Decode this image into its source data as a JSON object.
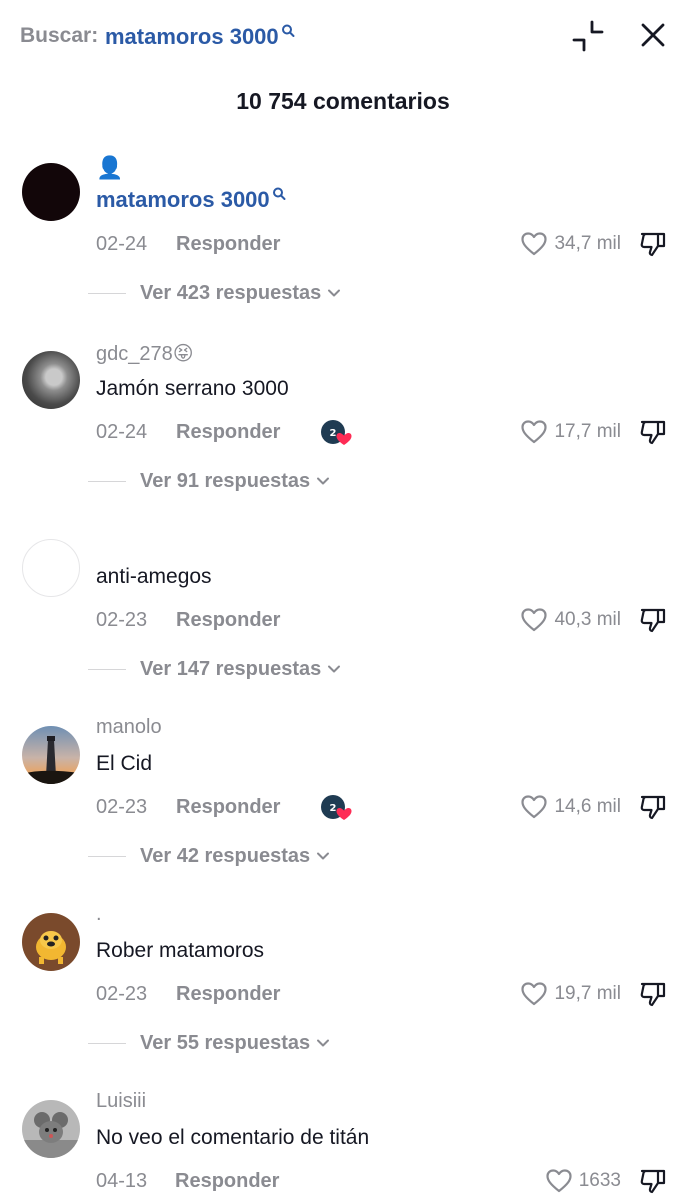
{
  "search": {
    "prefix": "Buscar:",
    "term": "matamoros 3000"
  },
  "header": {
    "comment_count": "10 754 comentarios"
  },
  "comments": [
    {
      "username": "👤",
      "username_link": "matamoros 3000",
      "text": "",
      "date": "02-24",
      "reply_label": "Responder",
      "likes": "34,7 mil",
      "creator_liked": false,
      "view_replies": "Ver 423 respuestas",
      "avatar": "dark-avatar"
    },
    {
      "username": "gdc_278😝",
      "text": "Jamón serrano 3000",
      "date": "02-24",
      "reply_label": "Responder",
      "likes": "17,7 mil",
      "creator_liked": true,
      "view_replies": "Ver 91 respuestas",
      "avatar": "photo-avatar"
    },
    {
      "username": "",
      "text": "anti-amegos",
      "date": "02-23",
      "reply_label": "Responder",
      "likes": "40,3 mil",
      "creator_liked": false,
      "view_replies": "Ver 147 respuestas",
      "avatar": "blank-avatar"
    },
    {
      "username": "manolo",
      "text": "El Cid",
      "date": "02-23",
      "reply_label": "Responder",
      "likes": "14,6 mil",
      "creator_liked": true,
      "view_replies": "Ver 42 respuestas",
      "avatar": "lighthouse-avatar"
    },
    {
      "username": ".",
      "text": "Rober matamoros",
      "date": "02-23",
      "reply_label": "Responder",
      "likes": "19,7 mil",
      "creator_liked": false,
      "view_replies": "Ver 55 respuestas",
      "avatar": "cartoon-dog-avatar"
    },
    {
      "username": "Luisiii",
      "text": "No veo el comentario de titán",
      "date": "04-13",
      "reply_label": "Responder",
      "likes": "1633",
      "creator_liked": false,
      "view_replies": "",
      "avatar": "mouse-avatar"
    }
  ],
  "colors": {
    "link_blue": "#2b5aa6",
    "muted_gray": "#8a8b91",
    "text": "#161823"
  }
}
